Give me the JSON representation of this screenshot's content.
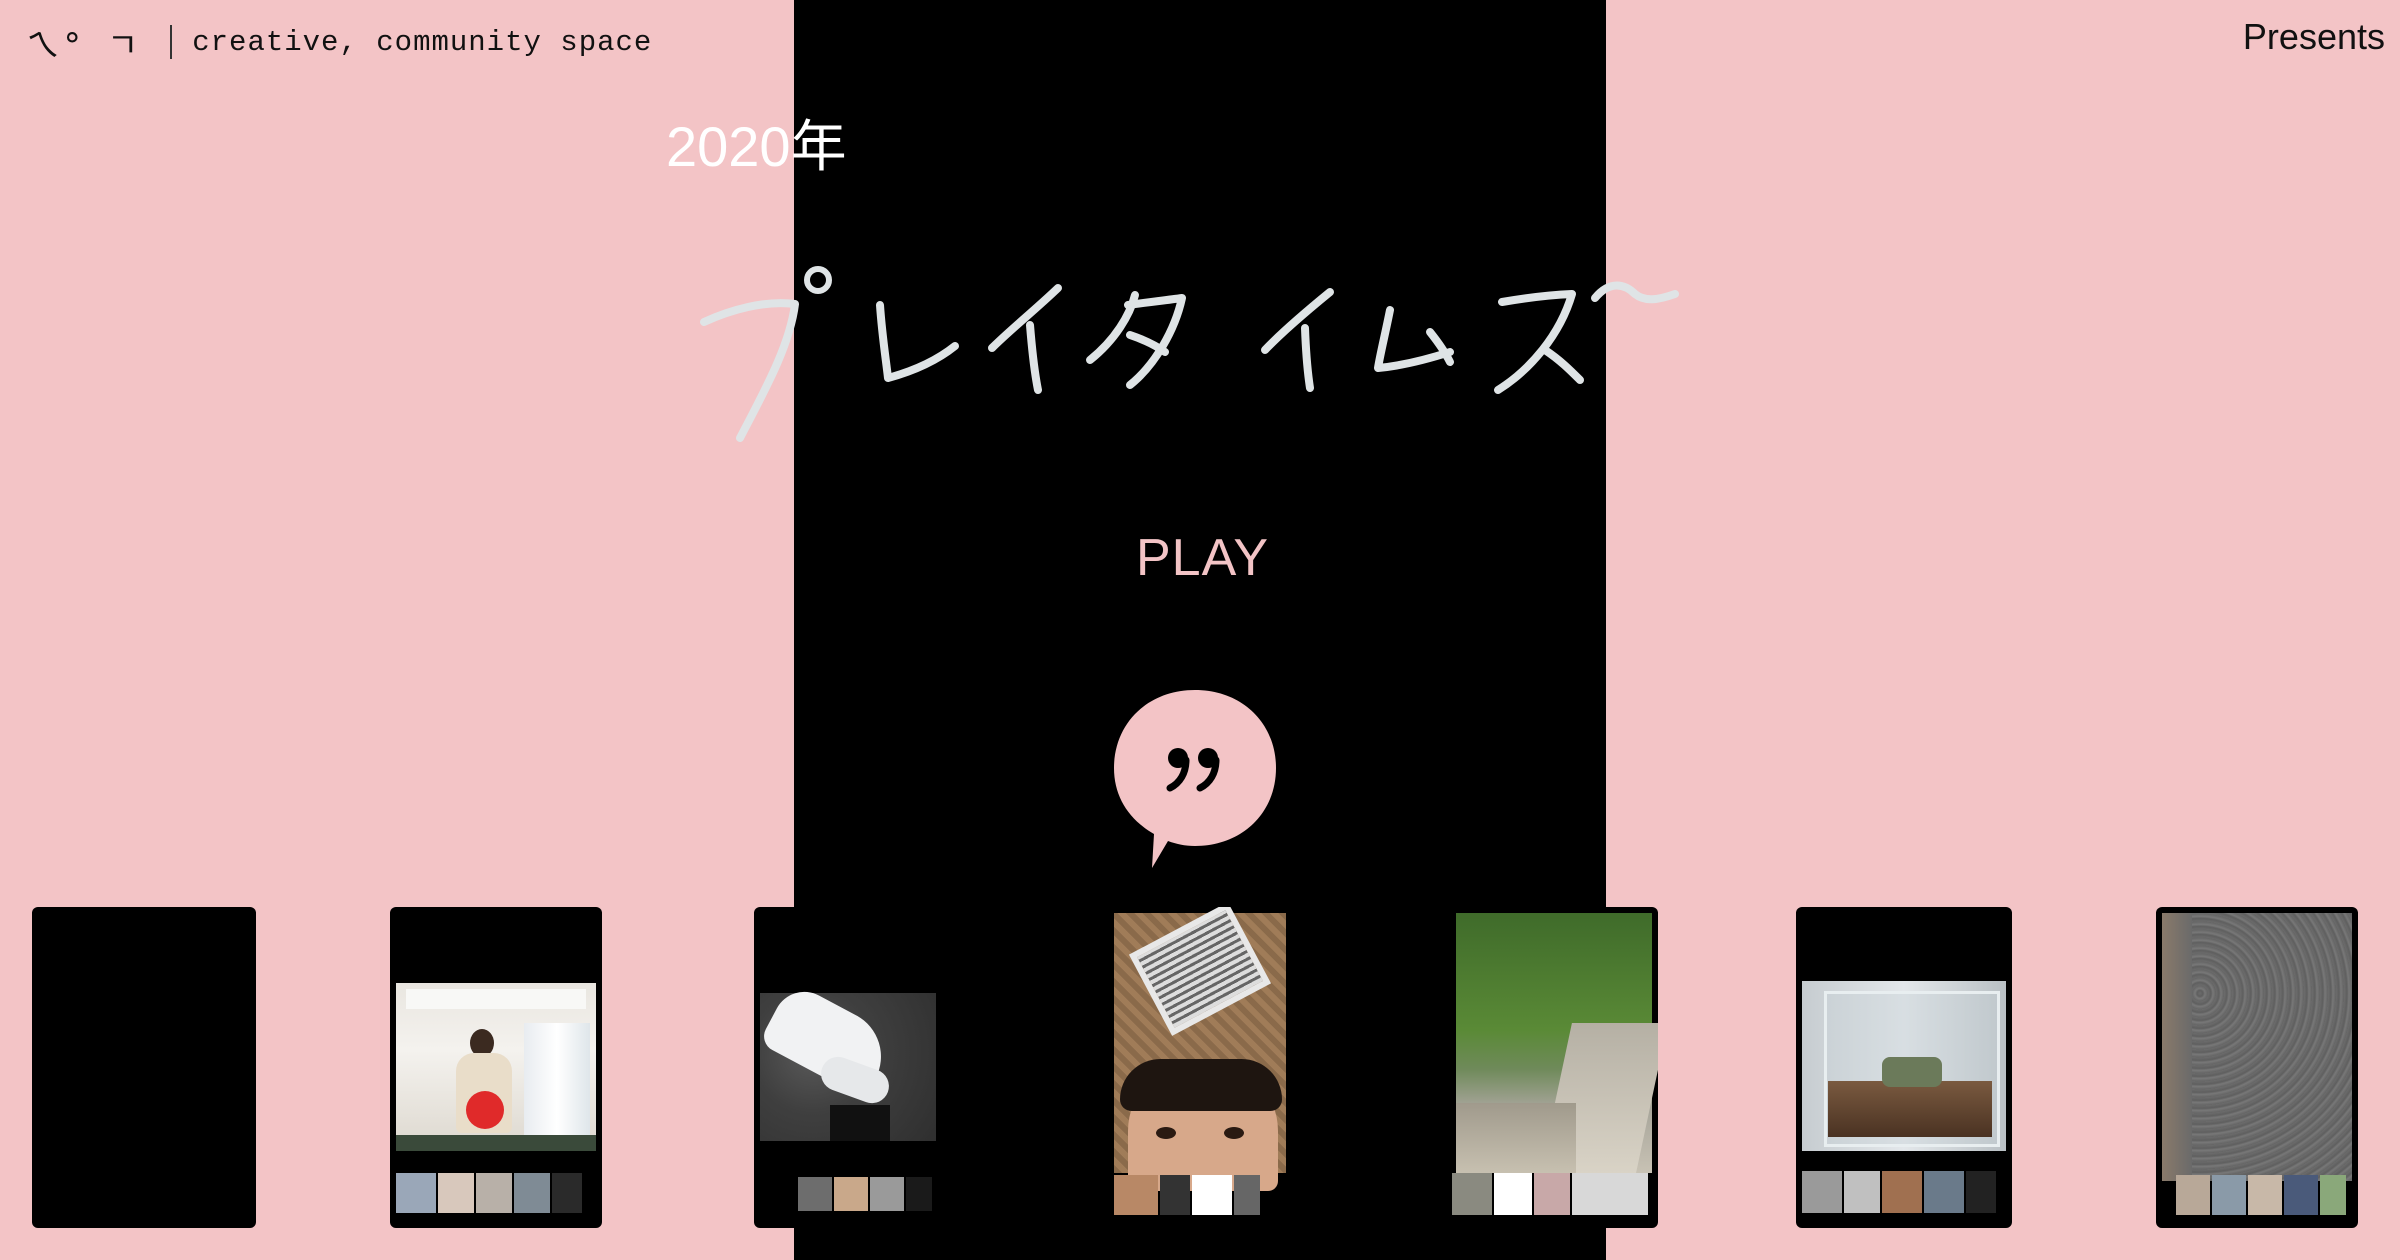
{
  "header": {
    "logo_mark": "ㄟ° ㄱ",
    "tagline": "creative, community space",
    "presents_label": "Presents"
  },
  "hero": {
    "year": "2020年",
    "title_image_alt": "プレイタイムス〜",
    "play_label": "PLAY",
    "bubble_glyph": "”"
  },
  "colors": {
    "background": "#f3c4c6",
    "panel": "#000000",
    "accent": "#f3c4c6",
    "title_stroke": "#dfe4e6"
  },
  "cards": [
    {
      "name": "video-card-1",
      "content": "black"
    },
    {
      "name": "video-card-2",
      "content": "person holding red ball in room"
    },
    {
      "name": "video-card-3",
      "content": "white sneaker on asphalt"
    },
    {
      "name": "video-card-4",
      "content": "selfie face with ceiling vent"
    },
    {
      "name": "video-card-5",
      "content": "green grass by stone steps"
    },
    {
      "name": "video-card-6",
      "content": "glass terrarium"
    },
    {
      "name": "video-card-7",
      "content": "gray asphalt ground"
    }
  ]
}
